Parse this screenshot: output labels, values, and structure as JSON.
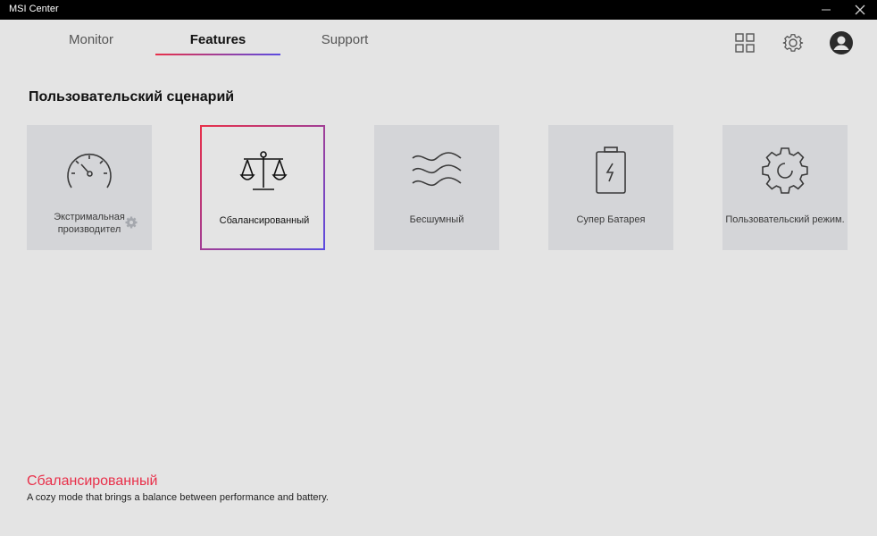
{
  "window": {
    "title": "MSI Center"
  },
  "tabs": [
    {
      "label": "Monitor"
    },
    {
      "label": "Features"
    },
    {
      "label": "Support"
    }
  ],
  "active_tab": "Features",
  "top_icons": [
    "grid-icon",
    "gear-icon",
    "avatar-icon"
  ],
  "section": {
    "title": "Пользовательский сценарий"
  },
  "cards": [
    {
      "label": "Экстримальная производител",
      "icon": "speedometer-icon"
    },
    {
      "label": "Сбалансированный",
      "icon": "balance-scale-icon"
    },
    {
      "label": "Бесшумный",
      "icon": "waves-icon"
    },
    {
      "label": "Супер Батарея",
      "icon": "battery-icon"
    },
    {
      "label": "Пользовательский режим.",
      "icon": "gear-icon"
    }
  ],
  "selected_card": "Сбалансированный",
  "description": {
    "title": "Сбалансированный",
    "text": "A cozy mode that brings a balance between performance and battery."
  },
  "colors": {
    "accent_red": "#e8304a",
    "accent_purple": "#5b4be0",
    "background": "#e4e4e4",
    "card": "#d4d5d8"
  }
}
